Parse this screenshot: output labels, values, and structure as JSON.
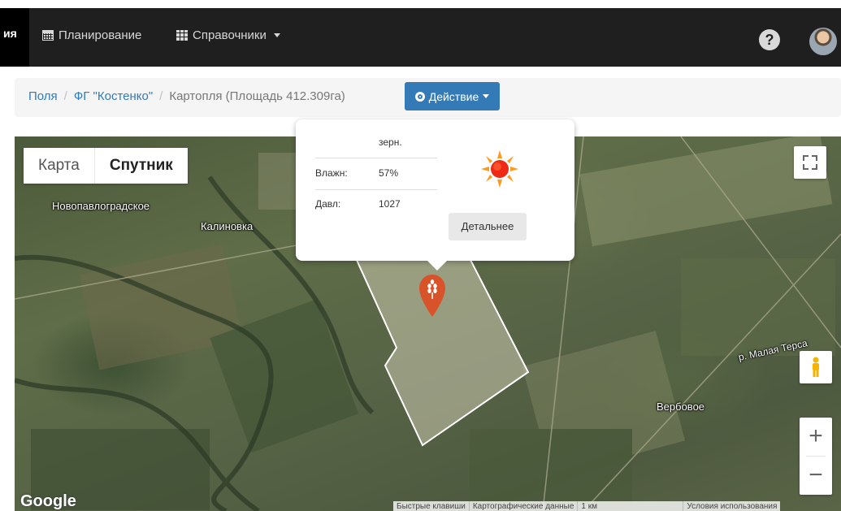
{
  "navbar": {
    "brand_fragment": "ия",
    "planning_label": "Планирование",
    "references_label": "Справочники",
    "help_label": "?"
  },
  "breadcrumb": {
    "items": [
      "Поля",
      "ФГ \"Костенко\""
    ],
    "separator": "/",
    "current": "Картопля (Площадь 412.309га)"
  },
  "action_button": {
    "label": "Действие"
  },
  "map": {
    "type_map_label": "Карта",
    "type_satellite_label": "Спутник",
    "selected_type": "Спутник",
    "labels": {
      "novopavlogradskoe": "Новопавлоградское",
      "kalinovka": "Калиновка",
      "malaya_tersa": "р. Малая Терса",
      "verbovoe": "Вербовое"
    },
    "logo": "Google",
    "attribution": {
      "shortcuts": "Быстрые клавиши",
      "map_data": "Картографические данные",
      "scale": "1 км",
      "terms": "Условия использования"
    },
    "zoom_in": "+",
    "zoom_out": "−"
  },
  "weather_popup": {
    "partial_top": "зерн.",
    "rows": [
      {
        "label": "Влажн:",
        "value": "57%"
      },
      {
        "label": "Давл:",
        "value": "1027"
      }
    ],
    "details_button": "Детальнее"
  }
}
